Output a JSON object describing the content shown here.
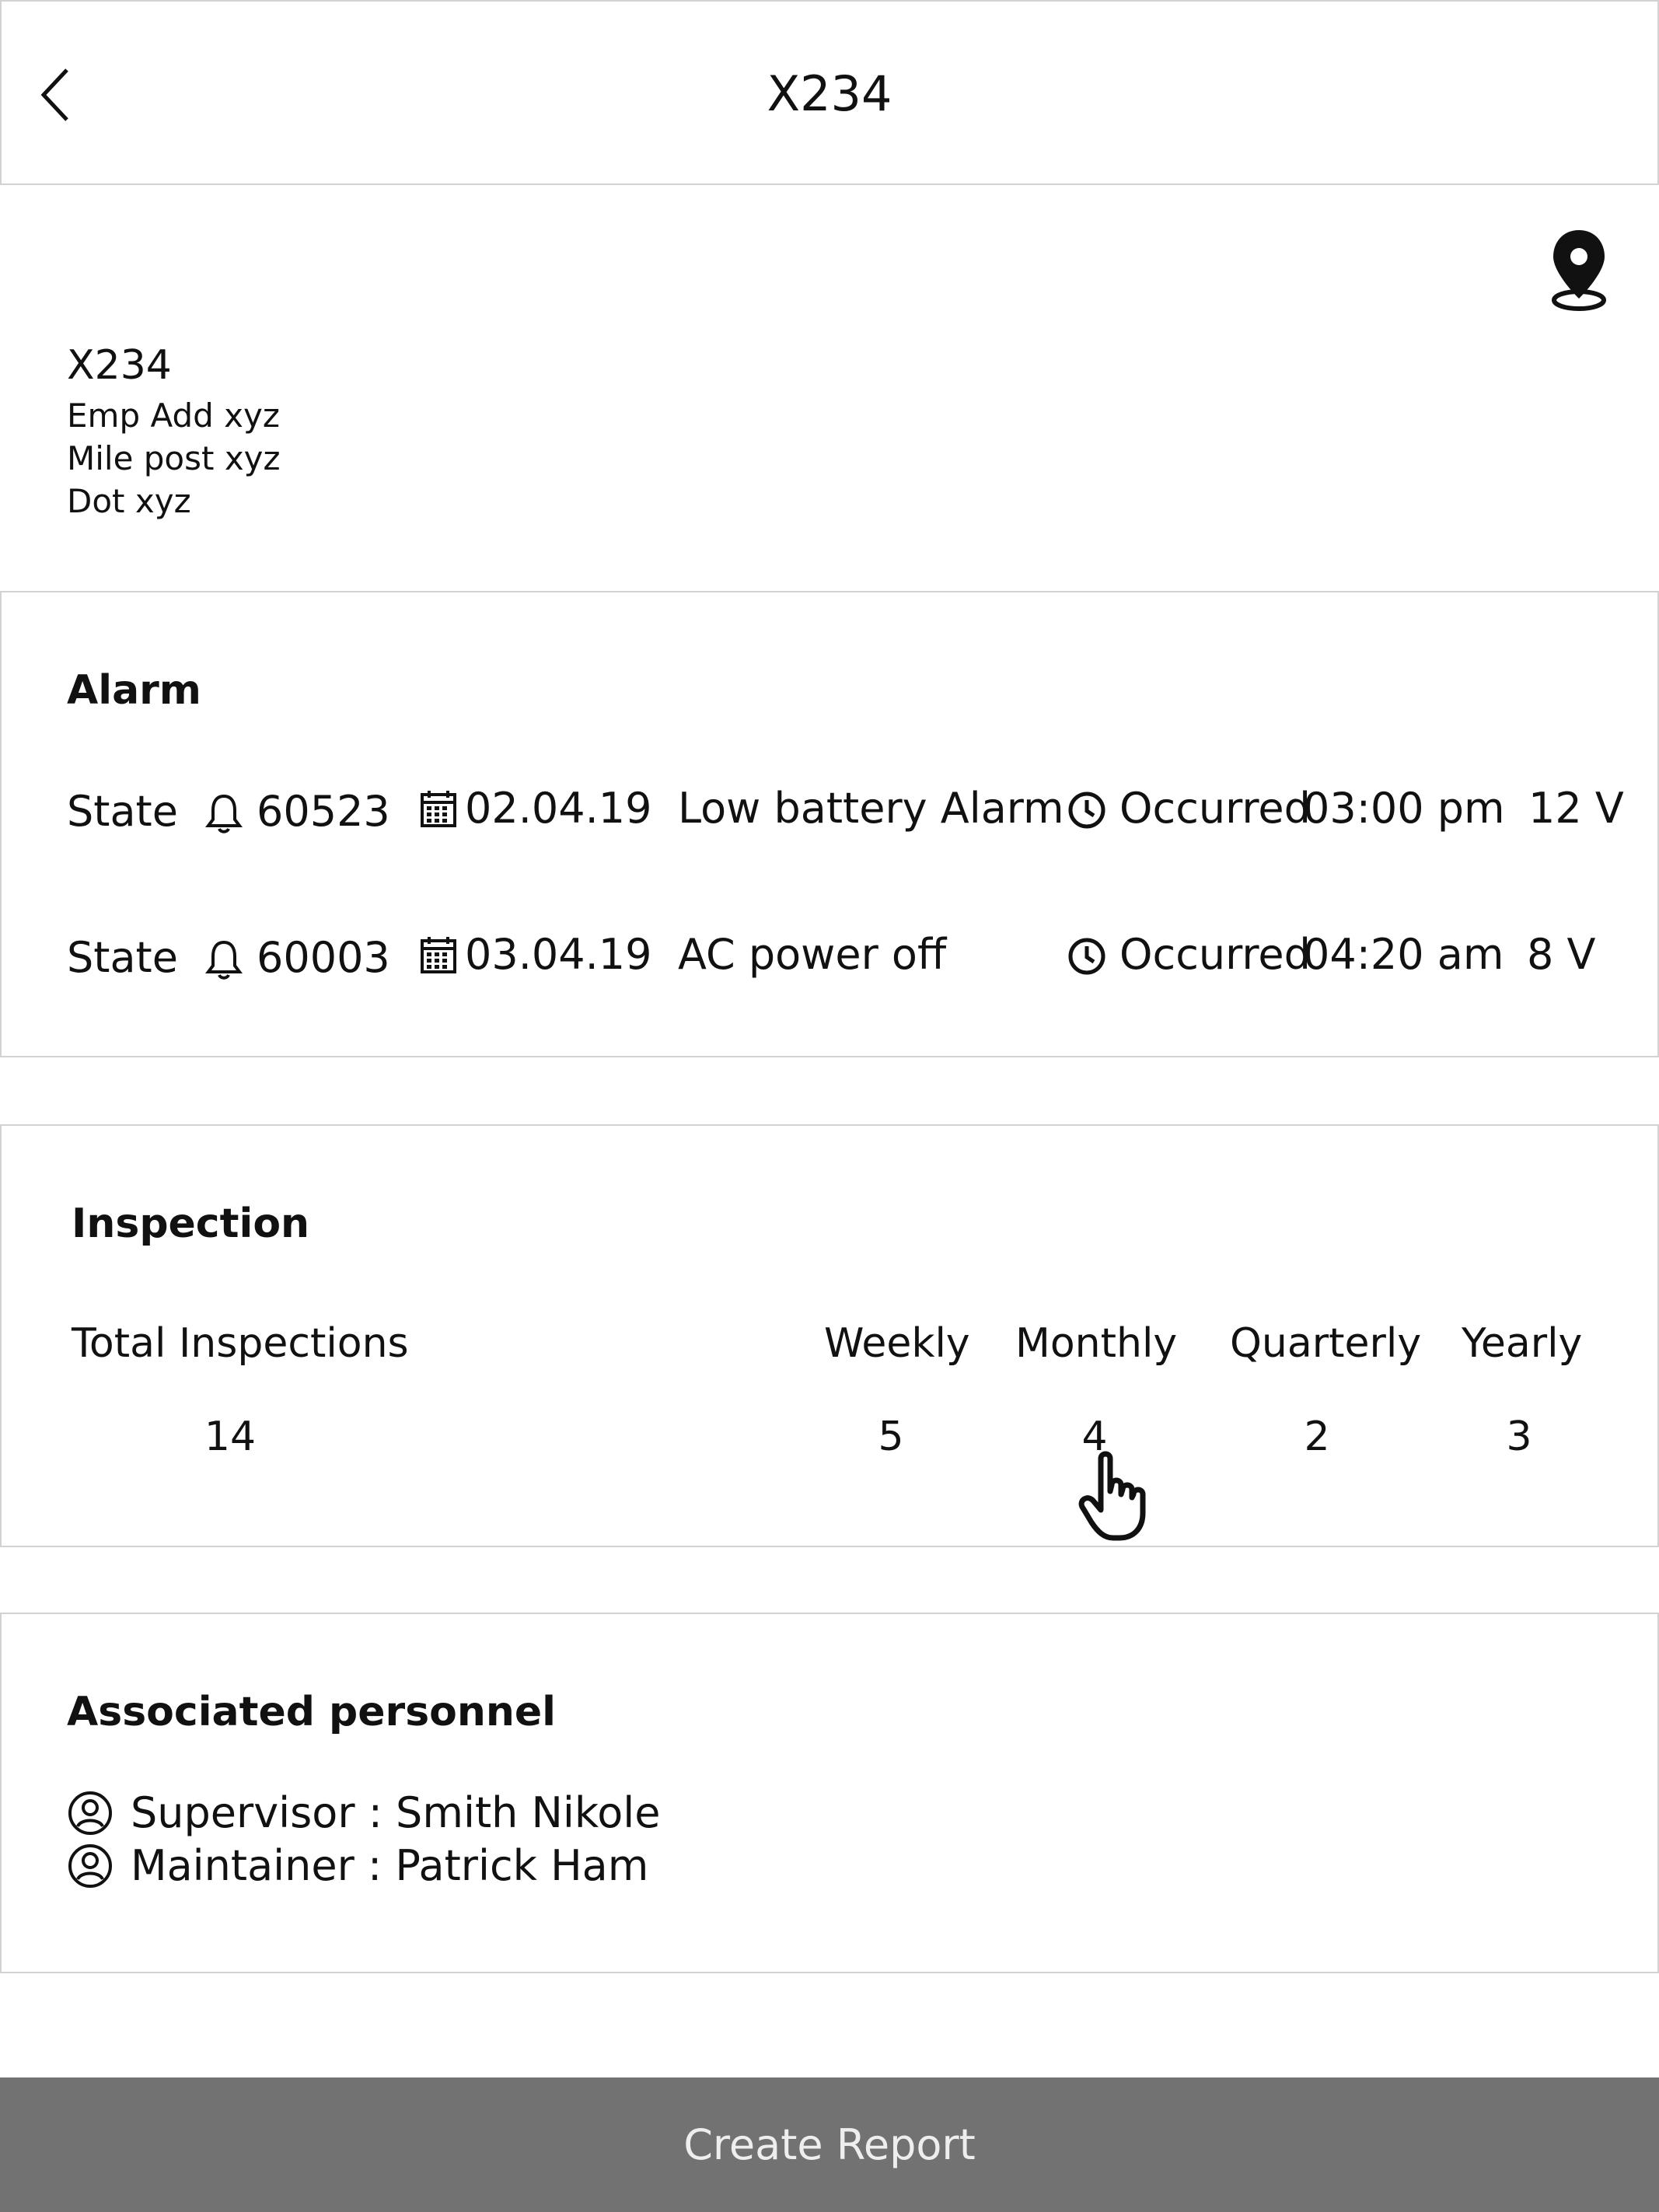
{
  "header": {
    "title": "X234"
  },
  "device": {
    "name": "X234",
    "lines": [
      "Emp Add xyz",
      "Mile post xyz",
      "Dot xyz"
    ]
  },
  "alarm": {
    "title": "Alarm",
    "rows": [
      {
        "state": "State",
        "id": "60523",
        "date": "02.04.19",
        "description": "Low battery Alarm",
        "occurred_label": "Occurred",
        "time": "03:00 pm",
        "voltage": "12 V"
      },
      {
        "state": "State",
        "id": "60003",
        "date": "03.04.19",
        "description": "AC power off",
        "occurred_label": "Occurred",
        "time": "04:20 am",
        "voltage": "8 V"
      }
    ]
  },
  "inspection": {
    "title": "Inspection",
    "total_label": "Total Inspections",
    "total_value": "14",
    "columns": [
      {
        "label": "Weekly",
        "value": "5"
      },
      {
        "label": "Monthly",
        "value": "4"
      },
      {
        "label": "Quarterly",
        "value": "2"
      },
      {
        "label": "Yearly",
        "value": "3"
      }
    ]
  },
  "personnel": {
    "title": "Associated personnel",
    "people": [
      {
        "text": "Supervisor : Smith Nikole"
      },
      {
        "text": "Maintainer : Patrick Ham"
      }
    ]
  },
  "actions": {
    "create_report": "Create Report"
  },
  "icons": {
    "back": "chevron-left-icon",
    "location": "map-pin-icon",
    "bell": "bell-icon",
    "calendar": "calendar-icon",
    "clock": "clock-icon",
    "person": "user-circle-icon",
    "cursor": "hand-pointer-icon"
  },
  "colors": {
    "button_bg": "#717271",
    "border": "#d2d2d2"
  }
}
